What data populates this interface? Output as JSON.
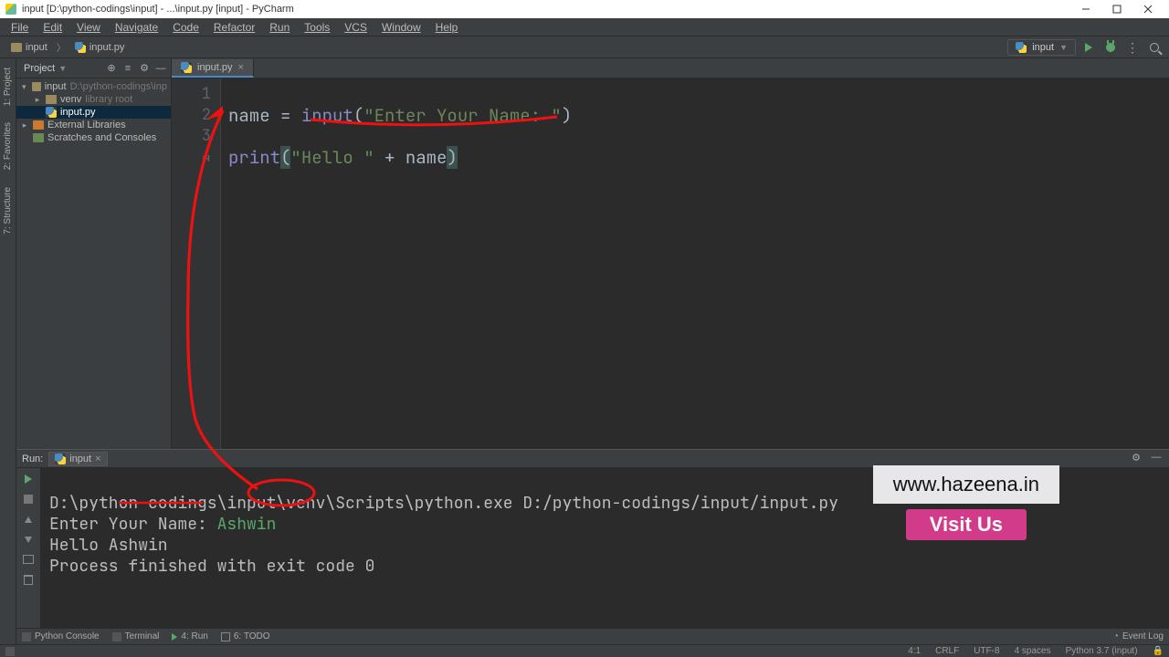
{
  "window": {
    "title": "input [D:\\python-codings\\input] - ...\\input.py [input] - PyCharm"
  },
  "menubar": [
    "File",
    "Edit",
    "View",
    "Navigate",
    "Code",
    "Refactor",
    "Run",
    "Tools",
    "VCS",
    "Window",
    "Help"
  ],
  "breadcrumb": {
    "project": "input",
    "file": "input.py"
  },
  "run_config": {
    "label": "input"
  },
  "project_tool": {
    "title": "Project",
    "root": {
      "name": "input",
      "hint": "D:\\python-codings\\inp"
    },
    "venv": {
      "name": "venv",
      "hint": "library root"
    },
    "file": {
      "name": "input.py"
    },
    "extlib": "External Libraries",
    "scratch": "Scratches and Consoles"
  },
  "editor": {
    "tab_label": "input.py",
    "gutter": [
      "1",
      "2",
      "3",
      "4"
    ],
    "code": {
      "l2_name": "name",
      "l2_eq": " = ",
      "l2_fn": "input",
      "l2_paren_open": "(",
      "l2_str": "\"Enter Your Name: \"",
      "l2_paren_close": ")",
      "l4_fn": "print",
      "l4_paren_open": "(",
      "l4_str": "\"Hello \"",
      "l4_plus": " + ",
      "l4_name": "name",
      "l4_paren_close": ")"
    }
  },
  "run_panel": {
    "title": "Run:",
    "tab": "input",
    "lines": {
      "cmd": "D:\\python-codings\\input\\venv\\Scripts\\python.exe D:/python-codings/input/input.py",
      "prompt": "Enter Your Name: ",
      "user_input": "Ashwin",
      "output": "Hello Ashwin",
      "blank": "",
      "exit": "Process finished with exit code 0"
    }
  },
  "left_rail": {
    "project": "1: Project",
    "favorites": "2: Favorites",
    "structure": "7: Structure"
  },
  "bottom_tabs": {
    "console": "Python Console",
    "terminal": "Terminal",
    "run": "4: Run",
    "todo": "6: TODO",
    "eventlog": "Event Log"
  },
  "statusbar": {
    "pos": "4:1",
    "crlf": "CRLF",
    "enc": "UTF-8",
    "indent": "4 spaces",
    "python": "Python 3.7 (input)"
  },
  "promo": {
    "url": "www.hazeena.in",
    "btn": "Visit Us"
  }
}
